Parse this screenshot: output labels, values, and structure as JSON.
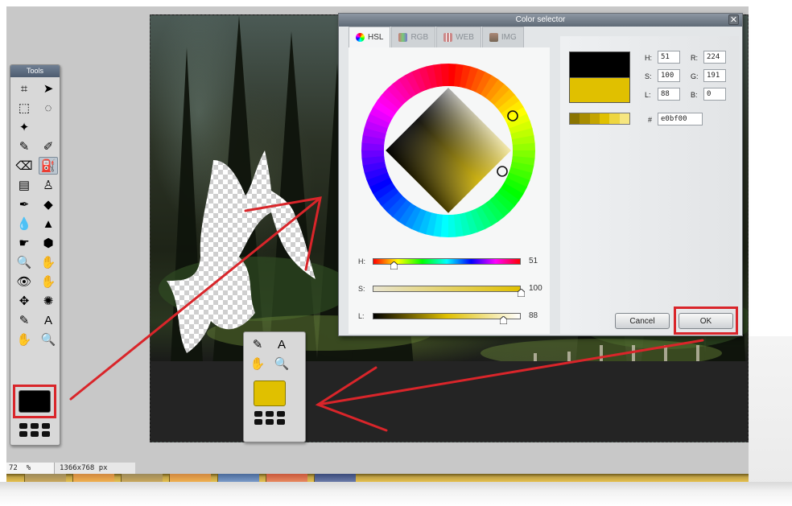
{
  "dialog": {
    "title": "Color selector",
    "close_glyph": "✕",
    "tabs": [
      {
        "label": "HSL",
        "icon": "hsl-wheel-icon",
        "active": true
      },
      {
        "label": "RGB",
        "icon": "rgb-icon",
        "active": false
      },
      {
        "label": "WEB",
        "icon": "web-grid-icon",
        "active": false
      },
      {
        "label": "IMG",
        "icon": "image-icon",
        "active": false
      }
    ],
    "sliders": {
      "h": {
        "label": "H:",
        "value": "51",
        "fraction": 0.14
      },
      "s": {
        "label": "S:",
        "value": "100",
        "fraction": 1.0
      },
      "l": {
        "label": "L:",
        "value": "88",
        "fraction": 0.88
      }
    },
    "fields": {
      "h": {
        "label": "H:",
        "value": "51"
      },
      "s": {
        "label": "S:",
        "value": "100"
      },
      "l": {
        "label": "L:",
        "value": "88"
      },
      "r": {
        "label": "R:",
        "value": "224"
      },
      "g": {
        "label": "G:",
        "value": "191"
      },
      "b": {
        "label": "B:",
        "value": "0"
      },
      "hex": {
        "label": "#",
        "value": "e0bf00"
      }
    },
    "buttons": {
      "cancel": "Cancel",
      "ok": "OK"
    },
    "colors": {
      "new": "#000000",
      "old": "#e0c000"
    }
  },
  "tools": {
    "title": "Tools",
    "items": [
      {
        "icon": "crop-icon",
        "glyph": "⌗"
      },
      {
        "icon": "move-icon",
        "glyph": "➤"
      },
      {
        "icon": "marquee-select-icon",
        "glyph": "⬚"
      },
      {
        "icon": "lasso-icon",
        "glyph": "◌"
      },
      {
        "icon": "magic-wand-icon",
        "glyph": "✦"
      },
      {
        "icon": "blank",
        "glyph": ""
      },
      {
        "icon": "pencil-icon",
        "glyph": "✎"
      },
      {
        "icon": "brush-icon",
        "glyph": "✐"
      },
      {
        "icon": "eraser-icon",
        "glyph": "⌫"
      },
      {
        "icon": "paint-bucket-icon",
        "glyph": "⛽"
      },
      {
        "icon": "gradient-icon",
        "glyph": "▤"
      },
      {
        "icon": "clone-stamp-icon",
        "glyph": "♙"
      },
      {
        "icon": "color-replace-icon",
        "glyph": "✒"
      },
      {
        "icon": "drawing-icon",
        "glyph": "◆"
      },
      {
        "icon": "blur-icon",
        "glyph": "💧"
      },
      {
        "icon": "sharpen-icon",
        "glyph": "▲"
      },
      {
        "icon": "smudge-icon",
        "glyph": "☛"
      },
      {
        "icon": "sponge-icon",
        "glyph": "⬢"
      },
      {
        "icon": "dodge-icon",
        "glyph": "🔍"
      },
      {
        "icon": "burn-icon",
        "glyph": "✋"
      },
      {
        "icon": "red-eye-icon",
        "glyph": "👁"
      },
      {
        "icon": "spot-heal-icon",
        "glyph": "✋"
      },
      {
        "icon": "bloat-icon",
        "glyph": "✥"
      },
      {
        "icon": "pinch-icon",
        "glyph": "✺"
      },
      {
        "icon": "color-picker-icon",
        "glyph": "✎"
      },
      {
        "icon": "type-icon",
        "glyph": "A"
      },
      {
        "icon": "hand-icon",
        "glyph": "✋"
      },
      {
        "icon": "zoom-icon",
        "glyph": "🔍"
      }
    ],
    "colors": {
      "primary": "#000000"
    }
  },
  "zoom_panel": {
    "items": [
      {
        "icon": "color-picker-icon",
        "glyph": "✎"
      },
      {
        "icon": "type-icon",
        "glyph": "A"
      },
      {
        "icon": "hand-icon",
        "glyph": "✋"
      },
      {
        "icon": "zoom-icon",
        "glyph": "🔍"
      }
    ],
    "colors": {
      "primary": "#e0c000"
    }
  },
  "status": {
    "zoom": "72",
    "zoom_unit": "%",
    "size": "1366x768 px"
  },
  "annotation": {
    "highlight_color": "#d9252a"
  }
}
